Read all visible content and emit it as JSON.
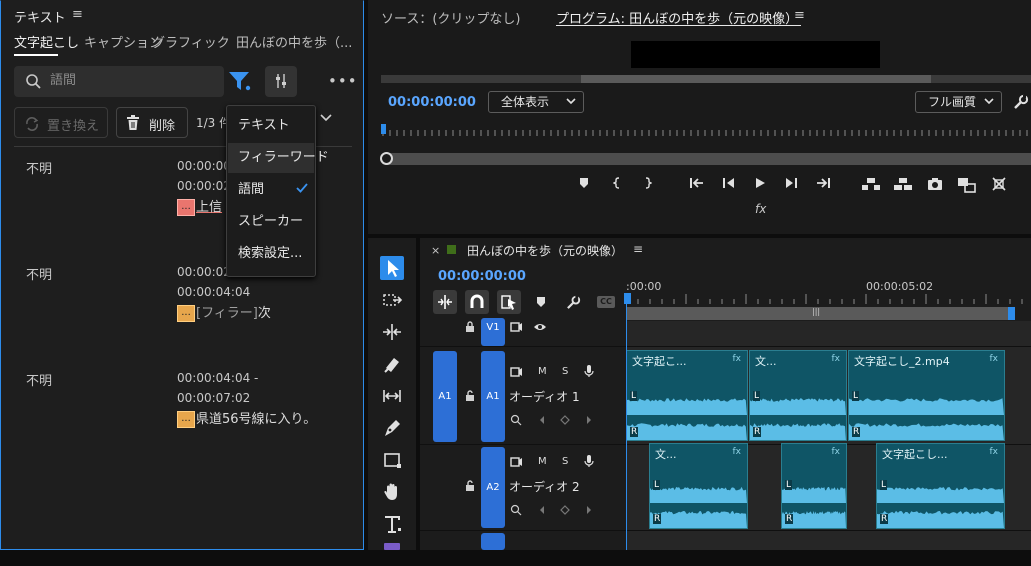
{
  "text_panel": {
    "title": "テキスト",
    "menu_glyph": "≡",
    "tabs": [
      "文字起こし",
      "キャプション",
      "グラフィック",
      "田んぼの中を歩（..."
    ],
    "active_tab": 0,
    "search_placeholder": "語間",
    "replace_label": "置き換え",
    "delete_label": "削除",
    "count_text": "1/3 件",
    "more_glyph": "•••",
    "segments": [
      {
        "speaker": "不明",
        "tc_start": "00:00:00",
        "tc_end": "00:00:02",
        "box": "...",
        "text": "上信"
      },
      {
        "speaker": "不明",
        "tc_start": "00:00:02",
        "tc_end": "00:00:04:04",
        "box": "...",
        "tag": "[フィラー]",
        "text": "次"
      },
      {
        "speaker": "不明",
        "tc_start": "00:00:04:04 -",
        "tc_end": "00:00:07:02",
        "box": "...",
        "text": "県道56号線に入り。"
      }
    ],
    "filter_menu": {
      "items": [
        "テキスト",
        "フィラーワード",
        "語間",
        "スピーカー",
        "検索設定..."
      ],
      "highlighted": 1,
      "checked": 2
    }
  },
  "program_monitor": {
    "source_tab": "ソース：(クリップなし)",
    "program_tab": "プログラム: 田んぼの中を歩（元の映像）",
    "tab_menu": "≡",
    "timecode": "00:00:00:00",
    "zoom_value": "全体表示",
    "quality_value": "フル画質",
    "fx_label": "fx",
    "transport": [
      "marker-icon",
      "mark-in-icon",
      "mark-out-icon",
      "go-to-in-icon",
      "step-back-icon",
      "play-icon",
      "step-forward-icon",
      "go-to-out-icon",
      "lift-icon",
      "extract-icon",
      "export-frame-icon",
      "compare-icon",
      "button-editor-icon"
    ]
  },
  "timeline": {
    "close_glyph": "×",
    "sequence_title": "田んぼの中を歩（元の映像）",
    "menu_glyph": "≡",
    "timecode": "00:00:00:00",
    "tick_labels": [
      ":00:00",
      "00:00:05:02"
    ],
    "tracks": {
      "v1": {
        "label": "V1"
      },
      "a1": {
        "source": "A1",
        "label": "A1",
        "name": "オーディオ 1",
        "m": "M",
        "s": "S"
      },
      "a2": {
        "label": "A2",
        "name": "オーディオ 2",
        "m": "M",
        "s": "S"
      }
    },
    "clips_a1": [
      "文字起こ...",
      "文...",
      "文字起こし_2.mp4"
    ],
    "clips_a2": [
      "文...",
      "",
      "文字起こし..."
    ],
    "channel_labels": [
      "L",
      "R"
    ],
    "fx_label": "fx",
    "cc_label": "CC"
  },
  "colors": {
    "accent": "#2d8ceb",
    "clip": "#0f5566",
    "waveform": "#5bbde6",
    "filler_box": "#e7a64c"
  }
}
